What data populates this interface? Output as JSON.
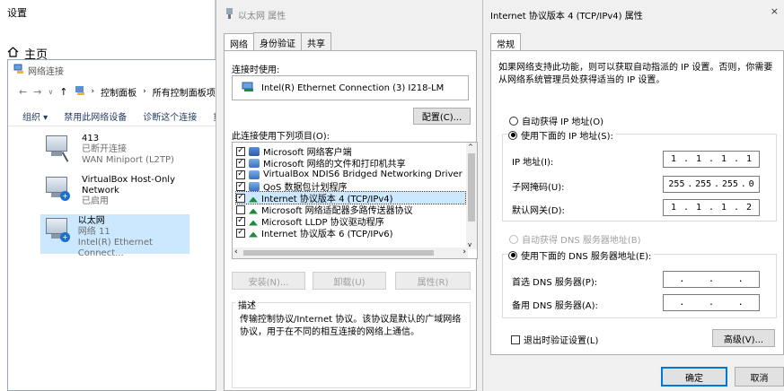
{
  "settings": {
    "title": "设置",
    "home": "主页"
  },
  "netconn": {
    "title": "网络连接",
    "breadcrumb": [
      "控制面板",
      "所有控制面板项"
    ],
    "toolbar": [
      "组织 ▾",
      "禁用此网络设备",
      "诊断这个连接",
      "重"
    ],
    "adapters": [
      {
        "name": "413",
        "status": "已断开连接",
        "device": "WAN Miniport (L2TP)",
        "selected": false
      },
      {
        "name": "VirtualBox Host-Only Network",
        "status": "已启用",
        "device": "",
        "selected": false
      },
      {
        "name": "以太网",
        "status": "网络 11",
        "device": "Intel(R) Ethernet Connect...",
        "selected": true
      }
    ]
  },
  "eth": {
    "title": "以太网 属性",
    "tabs": [
      "网络",
      "身份验证",
      "共享"
    ],
    "connect_using_label": "连接时使用:",
    "adapter_name": "Intel(R) Ethernet Connection (3) I218-LM",
    "configure_button": "配置(C)...",
    "items_label": "此连接使用下列项目(O):",
    "items": [
      {
        "label": "Microsoft 网络客户端",
        "checked": true,
        "kind": "client"
      },
      {
        "label": "Microsoft 网络的文件和打印机共享",
        "checked": true,
        "kind": "service"
      },
      {
        "label": "VirtualBox NDIS6 Bridged Networking Driver",
        "checked": true,
        "kind": "service"
      },
      {
        "label": "QoS 数据包计划程序",
        "checked": true,
        "kind": "service"
      },
      {
        "label": "Internet 协议版本 4 (TCP/IPv4)",
        "checked": true,
        "kind": "proto",
        "selected": true
      },
      {
        "label": "Microsoft 网络适配器多路传送器协议",
        "checked": false,
        "kind": "proto"
      },
      {
        "label": "Microsoft LLDP 协议驱动程序",
        "checked": true,
        "kind": "proto"
      },
      {
        "label": "Internet 协议版本 6 (TCP/IPv6)",
        "checked": true,
        "kind": "proto"
      }
    ],
    "install_button": "安装(N)...",
    "uninstall_button": "卸载(U)",
    "properties_button": "属性(R)",
    "description_label": "描述",
    "description_text": "传输控制协议/Internet 协议。该协议是默认的广域网络协议，用于在不同的相互连接的网络上通信。"
  },
  "ipv4": {
    "title": "Internet 协议版本 4 (TCP/IPv4) 属性",
    "close": "×",
    "tab": "常规",
    "intro": "如果网络支持此功能，则可以获取自动指派的 IP 设置。否则，你需要从网络系统管理员处获得适当的 IP 设置。",
    "auto_ip": "自动获得 IP 地址(O)",
    "manual_ip": "使用下面的 IP 地址(S):",
    "ip_label": "IP 地址(I):",
    "ip_value": [
      "1",
      "1",
      "1",
      "1"
    ],
    "mask_label": "子网掩码(U):",
    "mask_value": [
      "255",
      "255",
      "255",
      "0"
    ],
    "gateway_label": "默认网关(D):",
    "gateway_value": [
      "1",
      "1",
      "1",
      "2"
    ],
    "auto_dns": "自动获得 DNS 服务器地址(B)",
    "manual_dns": "使用下面的 DNS 服务器地址(E):",
    "dns1_label": "首选 DNS 服务器(P):",
    "dns2_label": "备用 DNS 服务器(A):",
    "validate_on_exit": "退出时验证设置(L)",
    "advanced_button": "高级(V)...",
    "ok_button": "确定",
    "cancel_button": "取消"
  }
}
